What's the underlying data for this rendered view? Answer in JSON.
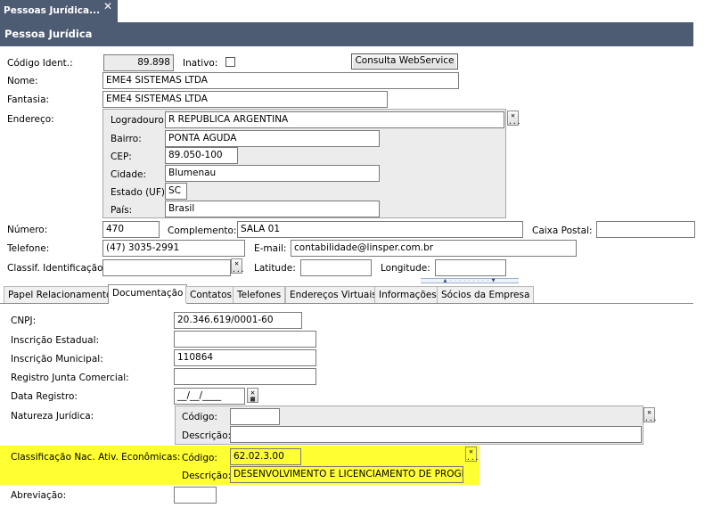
{
  "window": {
    "tab_title": "Pessoas Jurídica...",
    "close_glyph": "✕",
    "header": "Pessoa Jurídica"
  },
  "top": {
    "codigo_label": "Código Ident.:",
    "codigo_value": "89.898",
    "inativo_label": "Inativo:",
    "ws_button": "Consulta WebService",
    "nome_label": "Nome:",
    "nome_value": "EME4 SISTEMAS LTDA",
    "fantasia_label": "Fantasia:",
    "fantasia_value": "EME4 SISTEMAS LTDA",
    "endereco_label": "Endereço:"
  },
  "address": {
    "logradouro_label": "Logradouro:",
    "logradouro_value": "R REPUBLICA ARGENTINA",
    "bairro_label": "Bairro:",
    "bairro_value": "PONTA AGUDA",
    "cep_label": "CEP:",
    "cep_value": "89.050-100",
    "cidade_label": "Cidade:",
    "cidade_value": "Blumenau",
    "estado_label": "Estado (UF):",
    "estado_value": "SC",
    "pais_label": "País:",
    "pais_value": "Brasil"
  },
  "contact": {
    "numero_label": "Número:",
    "numero_value": "470",
    "complemento_label": "Complemento:",
    "complemento_value": "SALA 01",
    "caixa_label": "Caixa Postal:",
    "caixa_value": "",
    "telefone_label": "Telefone:",
    "telefone_value": "(47) 3035-2991",
    "email_label": "E-mail:",
    "email_value": "contabilidade@linsper.com.br",
    "classif_label": "Classif. Identificação:",
    "classif_value": "",
    "latitude_label": "Latitude:",
    "latitude_value": "",
    "longitude_label": "Longitude:",
    "longitude_value": ""
  },
  "tabs": [
    {
      "label": "Papel Relacionamento"
    },
    {
      "label": "Documentação"
    },
    {
      "label": "Contatos"
    },
    {
      "label": "Telefones"
    },
    {
      "label": "Endereços Virtuais"
    },
    {
      "label": "Informações"
    },
    {
      "label": "Sócios da Empresa"
    }
  ],
  "doc": {
    "cnpj_label": "CNPJ:",
    "cnpj_value": "20.346.619/0001-60",
    "ie_label": "Inscrição Estadual:",
    "ie_value": "",
    "im_label": "Inscrição Municipal:",
    "im_value": "110864",
    "rjc_label": "Registro Junta Comercial:",
    "rjc_value": "",
    "data_label": "Data Registro:",
    "data_value": "__/__/____",
    "natureza_label": "Natureza Jurídica:",
    "nat_codigo_label": "Código:",
    "nat_codigo_value": "",
    "nat_desc_label": "Descrição:",
    "nat_desc_value": "",
    "cnae_label": "Classificação Nac. Ativ. Econômicas:",
    "cnae_codigo_label": "Código:",
    "cnae_codigo_value": "62.02.3.00",
    "cnae_desc_label": "Descrição:",
    "cnae_desc_value": "DESENVOLVIMENTO E LICENCIAMENTO DE PROGRAM",
    "abrev_label": "Abreviação:",
    "abrev_value": ""
  },
  "colors": {
    "header_bg": "#4d5b73",
    "highlight": "#ffff33",
    "group_bg": "#ececec"
  }
}
